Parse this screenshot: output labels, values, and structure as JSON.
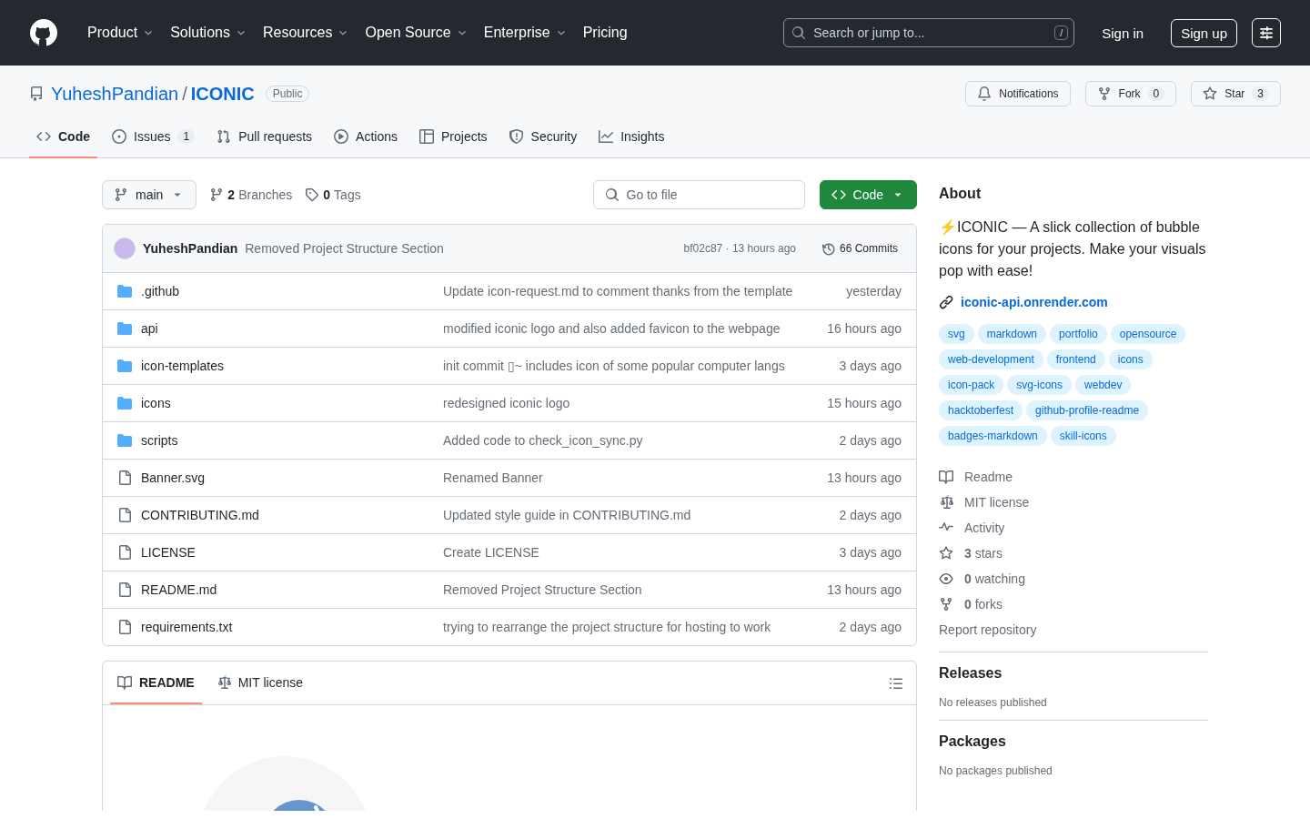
{
  "header": {
    "nav": [
      {
        "label": "Product",
        "dropdown": true
      },
      {
        "label": "Solutions",
        "dropdown": true
      },
      {
        "label": "Resources",
        "dropdown": true
      },
      {
        "label": "Open Source",
        "dropdown": true
      },
      {
        "label": "Enterprise",
        "dropdown": true
      },
      {
        "label": "Pricing",
        "dropdown": false
      }
    ],
    "search": {
      "placeholder": "Search or jump to...",
      "shortcut": "/"
    },
    "sign_in": "Sign in",
    "sign_up": "Sign up"
  },
  "repo": {
    "owner": "YuheshPandian",
    "separator": "/",
    "name": "ICONIC",
    "visibility": "Public",
    "actions": [
      {
        "kind": "notifications",
        "label": "Notifications"
      },
      {
        "kind": "fork",
        "label": "Fork",
        "count": "0"
      },
      {
        "kind": "star",
        "label": "Star",
        "count": "3"
      }
    ],
    "tabs": [
      {
        "kind": "code",
        "label": "Code",
        "selected": true
      },
      {
        "kind": "issues",
        "label": "Issues",
        "count": "1",
        "selected": false
      },
      {
        "kind": "pulls",
        "label": "Pull requests",
        "selected": false
      },
      {
        "kind": "actions",
        "label": "Actions",
        "selected": false
      },
      {
        "kind": "projects",
        "label": "Projects",
        "selected": false
      },
      {
        "kind": "security",
        "label": "Security",
        "selected": false
      },
      {
        "kind": "insights",
        "label": "Insights",
        "selected": false
      }
    ]
  },
  "toolbar": {
    "branch": "main",
    "branches_count": "2",
    "branches_label": "Branches",
    "tags_count": "0",
    "tags_label": "Tags",
    "go_to_file": {
      "placeholder": "Go to file"
    },
    "code_button": "Code"
  },
  "latest_commit": {
    "author": "YuheshPandian",
    "message": "Removed Project Structure Section",
    "hash_time": "bf02c87 · 13 hours ago",
    "commits": "66 Commits"
  },
  "files": [
    {
      "kind": "dir",
      "name": ".github",
      "message": "Update icon-request.md to comment thanks from the template",
      "time": "yesterday"
    },
    {
      "kind": "dir",
      "name": "api",
      "message": "modified iconic logo and also added favicon to the webpage",
      "time": "16 hours ago"
    },
    {
      "kind": "dir",
      "name": "icon-templates",
      "message": "init commit ▯~ includes icon of some popular computer langs",
      "time": "3 days ago"
    },
    {
      "kind": "dir",
      "name": "icons",
      "message": "redesigned iconic logo",
      "time": "15 hours ago"
    },
    {
      "kind": "dir",
      "name": "scripts",
      "message": "Added code to check_icon_sync.py",
      "time": "2 days ago"
    },
    {
      "kind": "file",
      "name": "Banner.svg",
      "message": "Renamed Banner",
      "time": "13 hours ago"
    },
    {
      "kind": "file",
      "name": "CONTRIBUTING.md",
      "message": "Updated style guide in CONTRIBUTING.md",
      "time": "2 days ago"
    },
    {
      "kind": "file",
      "name": "LICENSE",
      "message": "Create LICENSE",
      "time": "3 days ago"
    },
    {
      "kind": "file",
      "name": "README.md",
      "message": "Removed Project Structure Section",
      "time": "13 hours ago"
    },
    {
      "kind": "file",
      "name": "requirements.txt",
      "message": "trying to rearrange the project structure for hosting to work",
      "time": "2 days ago"
    }
  ],
  "readme": {
    "tabs": [
      {
        "kind": "readme",
        "label": "README",
        "selected": true
      },
      {
        "kind": "license",
        "label": "MIT license",
        "selected": false
      }
    ]
  },
  "about": {
    "title": "About",
    "description": "⚡ICONIC — A slick collection of bubble icons for your projects. Make your visuals pop with ease!",
    "website": "iconic-api.onrender.com",
    "topics": [
      "svg",
      "markdown",
      "portfolio",
      "opensource",
      "web-development",
      "frontend",
      "icons",
      "icon-pack",
      "svg-icons",
      "webdev",
      "hacktoberfest",
      "github-profile-readme",
      "badges-markdown",
      "skill-icons"
    ],
    "links": [
      {
        "kind": "readme",
        "label": "Readme"
      },
      {
        "kind": "license",
        "label": "MIT license"
      },
      {
        "kind": "activity",
        "label": "Activity"
      },
      {
        "kind": "stars",
        "count": "3",
        "label": "stars"
      },
      {
        "kind": "watching",
        "count": "0",
        "label": "watching"
      },
      {
        "kind": "forks",
        "count": "0",
        "label": "forks"
      }
    ],
    "report": "Report repository"
  },
  "releases": {
    "title": "Releases",
    "note": "No releases published"
  },
  "packages": {
    "title": "Packages",
    "note": "No packages published"
  }
}
